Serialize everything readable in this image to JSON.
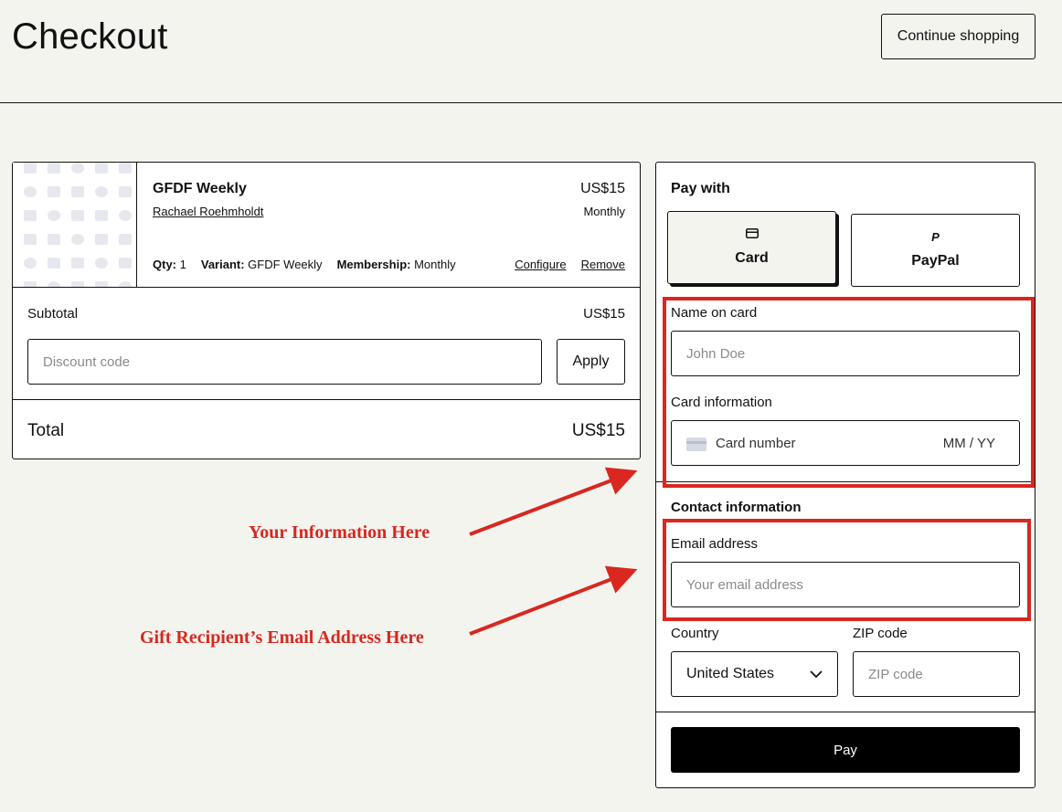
{
  "header": {
    "title": "Checkout",
    "continue_label": "Continue shopping"
  },
  "order": {
    "item": {
      "name": "GFDF Weekly",
      "author": "Rachael Roehmholdt",
      "price": "US$15",
      "period": "Monthly",
      "qty_label": "Qty:",
      "qty_value": "1",
      "variant_label": "Variant:",
      "variant_value": "GFDF Weekly",
      "membership_label": "Membership:",
      "membership_value": "Monthly",
      "configure_label": "Configure",
      "remove_label": "Remove"
    },
    "subtotal_label": "Subtotal",
    "subtotal_value": "US$15",
    "discount_placeholder": "Discount code",
    "apply_label": "Apply",
    "total_label": "Total",
    "total_value": "US$15"
  },
  "payment": {
    "pay_with_label": "Pay with",
    "methods": [
      {
        "label": "Card",
        "icon": "credit-card-icon",
        "selected": true
      },
      {
        "label": "PayPal",
        "icon": "paypal-icon",
        "selected": false
      }
    ],
    "name_label": "Name on card",
    "name_placeholder": "John Doe",
    "card_info_label": "Card information",
    "card_number_placeholder": "Card number",
    "card_expiry_placeholder": "MM / YY",
    "contact_heading": "Contact information",
    "email_label": "Email address",
    "email_placeholder": "Your email address",
    "country_label": "Country",
    "country_value": "United States",
    "zip_label": "ZIP code",
    "zip_placeholder": "ZIP code",
    "pay_label": "Pay"
  },
  "annotations": {
    "info_note": "Your Information Here",
    "email_note": "Gift Recipient’s Email Address Here",
    "color": "#d8281f"
  }
}
